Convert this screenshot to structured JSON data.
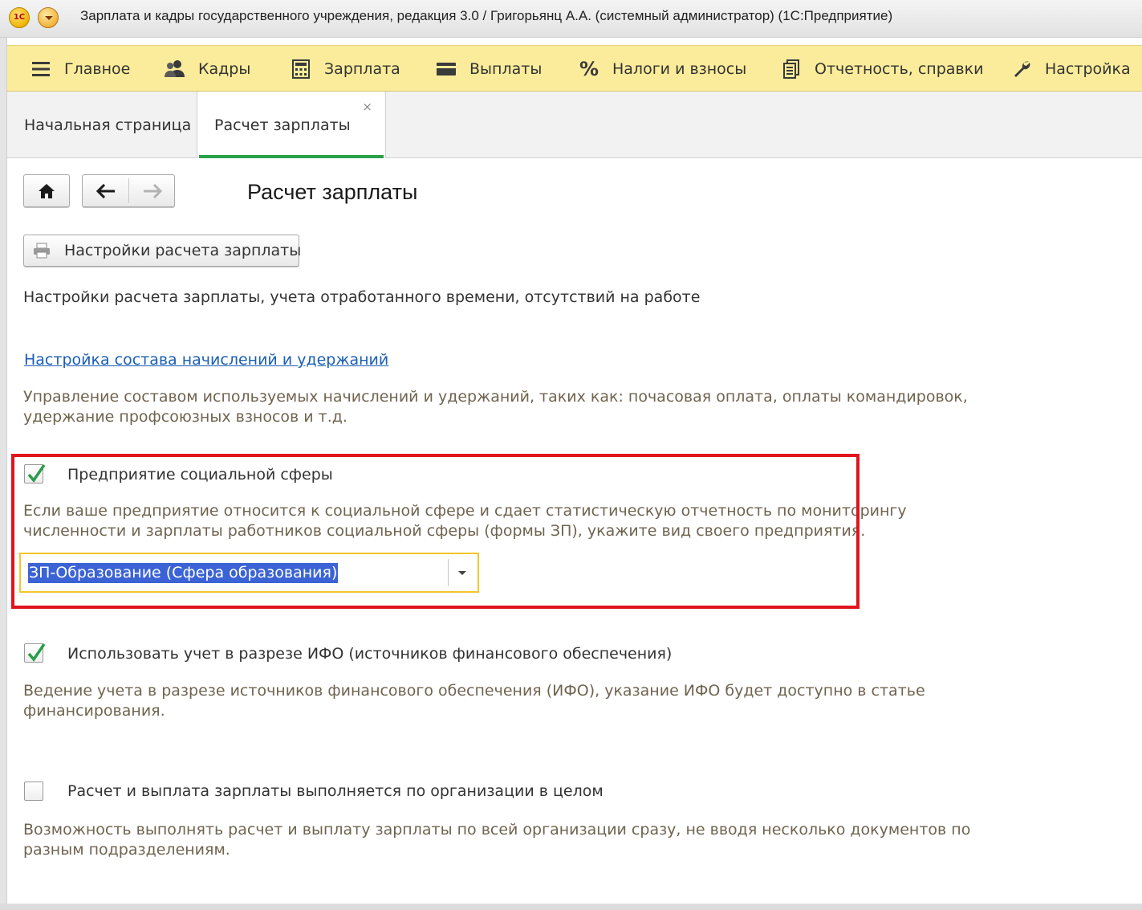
{
  "window": {
    "title": "Зарплата и кадры государственного учреждения, редакция 3.0 / Григорьянц А.А. (системный администратор)  (1С:Предприятие)",
    "logo_text": "1С"
  },
  "main_menu": [
    {
      "label": "Главное",
      "icon": "hamburger-icon"
    },
    {
      "label": "Кадры",
      "icon": "people-icon"
    },
    {
      "label": "Зарплата",
      "icon": "calculator-icon"
    },
    {
      "label": "Выплаты",
      "icon": "wallet-icon"
    },
    {
      "label": "Налоги и взносы",
      "icon": "percent-icon"
    },
    {
      "label": "Отчетность, справки",
      "icon": "reports-icon"
    },
    {
      "label": "Настройка",
      "icon": "wrench-icon"
    }
  ],
  "tabs": {
    "home_label": "Начальная страница",
    "active_label": "Расчет зарплаты",
    "close_glyph": "×"
  },
  "page": {
    "title": "Расчет зарплаты",
    "settings_button": "Настройки расчета зарплаты",
    "settings_description": "Настройки расчета зарплаты, учета отработанного времени, отсутствий на работе",
    "accruals_link": "Настройка состава начислений и удержаний",
    "accruals_hint_1": "Управление составом используемых начислений и удержаний, таких как: почасовая оплата, оплаты командировок,",
    "accruals_hint_2": "удержание профсоюзных взносов и т.д.",
    "social": {
      "checked": true,
      "label": "Предприятие социальной сферы",
      "hint_1": "Если ваше предприятие относится к социальной сфере и сдает статистическую отчетность по мониторингу",
      "hint_2": "численности и зарплаты работников социальной сферы (формы ЗП), укажите вид своего предприятия.",
      "select_value": "ЗП-Образование (Сфера образования)"
    },
    "ifo": {
      "checked": true,
      "label": "Использовать учет в разрезе ИФО (источников финансового обеспечения)",
      "hint_1": "Ведение учета в разрезе источников финансового обеспечения (ИФО), указание ИФО будет доступно в статье",
      "hint_2": "финансирования."
    },
    "whole_org": {
      "checked": false,
      "label": "Расчет и выплата зарплаты выполняется по организации в целом",
      "hint_1": "Возможность выполнять расчет и выплату зарплаты по всей организации сразу, не вводя несколько документов по",
      "hint_2": "разным подразделениям."
    }
  },
  "colors": {
    "menu_bar": "#fbec9b",
    "active_tab_underline": "#2aa14a",
    "highlight_frame": "#e0141e",
    "combo_border": "#f3c62a",
    "selection": "#3b63d6",
    "link": "#1a5fb4",
    "check": "#2a9d4a"
  }
}
